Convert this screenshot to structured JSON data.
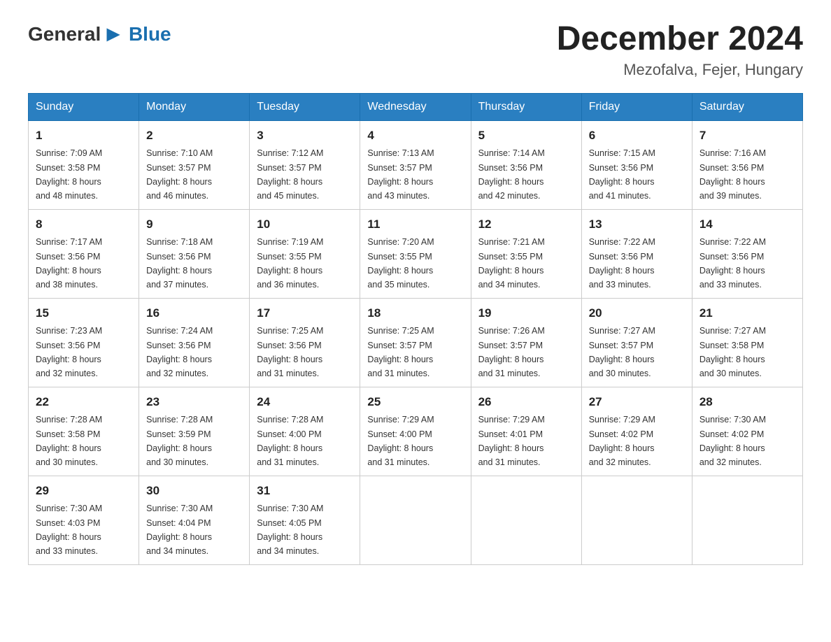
{
  "header": {
    "logo_general": "General",
    "logo_blue": "Blue",
    "month_title": "December 2024",
    "location": "Mezofalva, Fejer, Hungary"
  },
  "weekdays": [
    "Sunday",
    "Monday",
    "Tuesday",
    "Wednesday",
    "Thursday",
    "Friday",
    "Saturday"
  ],
  "weeks": [
    [
      {
        "day": "1",
        "sunrise": "7:09 AM",
        "sunset": "3:58 PM",
        "daylight": "8 hours and 48 minutes."
      },
      {
        "day": "2",
        "sunrise": "7:10 AM",
        "sunset": "3:57 PM",
        "daylight": "8 hours and 46 minutes."
      },
      {
        "day": "3",
        "sunrise": "7:12 AM",
        "sunset": "3:57 PM",
        "daylight": "8 hours and 45 minutes."
      },
      {
        "day": "4",
        "sunrise": "7:13 AM",
        "sunset": "3:57 PM",
        "daylight": "8 hours and 43 minutes."
      },
      {
        "day": "5",
        "sunrise": "7:14 AM",
        "sunset": "3:56 PM",
        "daylight": "8 hours and 42 minutes."
      },
      {
        "day": "6",
        "sunrise": "7:15 AM",
        "sunset": "3:56 PM",
        "daylight": "8 hours and 41 minutes."
      },
      {
        "day": "7",
        "sunrise": "7:16 AM",
        "sunset": "3:56 PM",
        "daylight": "8 hours and 39 minutes."
      }
    ],
    [
      {
        "day": "8",
        "sunrise": "7:17 AM",
        "sunset": "3:56 PM",
        "daylight": "8 hours and 38 minutes."
      },
      {
        "day": "9",
        "sunrise": "7:18 AM",
        "sunset": "3:56 PM",
        "daylight": "8 hours and 37 minutes."
      },
      {
        "day": "10",
        "sunrise": "7:19 AM",
        "sunset": "3:55 PM",
        "daylight": "8 hours and 36 minutes."
      },
      {
        "day": "11",
        "sunrise": "7:20 AM",
        "sunset": "3:55 PM",
        "daylight": "8 hours and 35 minutes."
      },
      {
        "day": "12",
        "sunrise": "7:21 AM",
        "sunset": "3:55 PM",
        "daylight": "8 hours and 34 minutes."
      },
      {
        "day": "13",
        "sunrise": "7:22 AM",
        "sunset": "3:56 PM",
        "daylight": "8 hours and 33 minutes."
      },
      {
        "day": "14",
        "sunrise": "7:22 AM",
        "sunset": "3:56 PM",
        "daylight": "8 hours and 33 minutes."
      }
    ],
    [
      {
        "day": "15",
        "sunrise": "7:23 AM",
        "sunset": "3:56 PM",
        "daylight": "8 hours and 32 minutes."
      },
      {
        "day": "16",
        "sunrise": "7:24 AM",
        "sunset": "3:56 PM",
        "daylight": "8 hours and 32 minutes."
      },
      {
        "day": "17",
        "sunrise": "7:25 AM",
        "sunset": "3:56 PM",
        "daylight": "8 hours and 31 minutes."
      },
      {
        "day": "18",
        "sunrise": "7:25 AM",
        "sunset": "3:57 PM",
        "daylight": "8 hours and 31 minutes."
      },
      {
        "day": "19",
        "sunrise": "7:26 AM",
        "sunset": "3:57 PM",
        "daylight": "8 hours and 31 minutes."
      },
      {
        "day": "20",
        "sunrise": "7:27 AM",
        "sunset": "3:57 PM",
        "daylight": "8 hours and 30 minutes."
      },
      {
        "day": "21",
        "sunrise": "7:27 AM",
        "sunset": "3:58 PM",
        "daylight": "8 hours and 30 minutes."
      }
    ],
    [
      {
        "day": "22",
        "sunrise": "7:28 AM",
        "sunset": "3:58 PM",
        "daylight": "8 hours and 30 minutes."
      },
      {
        "day": "23",
        "sunrise": "7:28 AM",
        "sunset": "3:59 PM",
        "daylight": "8 hours and 30 minutes."
      },
      {
        "day": "24",
        "sunrise": "7:28 AM",
        "sunset": "4:00 PM",
        "daylight": "8 hours and 31 minutes."
      },
      {
        "day": "25",
        "sunrise": "7:29 AM",
        "sunset": "4:00 PM",
        "daylight": "8 hours and 31 minutes."
      },
      {
        "day": "26",
        "sunrise": "7:29 AM",
        "sunset": "4:01 PM",
        "daylight": "8 hours and 31 minutes."
      },
      {
        "day": "27",
        "sunrise": "7:29 AM",
        "sunset": "4:02 PM",
        "daylight": "8 hours and 32 minutes."
      },
      {
        "day": "28",
        "sunrise": "7:30 AM",
        "sunset": "4:02 PM",
        "daylight": "8 hours and 32 minutes."
      }
    ],
    [
      {
        "day": "29",
        "sunrise": "7:30 AM",
        "sunset": "4:03 PM",
        "daylight": "8 hours and 33 minutes."
      },
      {
        "day": "30",
        "sunrise": "7:30 AM",
        "sunset": "4:04 PM",
        "daylight": "8 hours and 34 minutes."
      },
      {
        "day": "31",
        "sunrise": "7:30 AM",
        "sunset": "4:05 PM",
        "daylight": "8 hours and 34 minutes."
      },
      null,
      null,
      null,
      null
    ]
  ],
  "labels": {
    "sunrise": "Sunrise:",
    "sunset": "Sunset:",
    "daylight": "Daylight:"
  }
}
